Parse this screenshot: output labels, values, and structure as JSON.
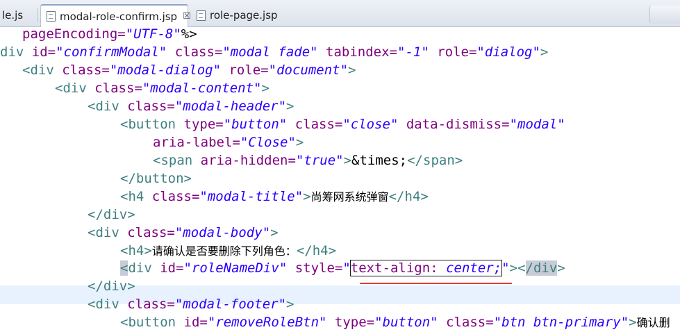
{
  "tabs": [
    {
      "label": "le.js",
      "active": false
    },
    {
      "label": "modal-role-confirm.jsp",
      "active": true,
      "close": "☒"
    },
    {
      "label": "role-page.jsp",
      "active": false
    }
  ],
  "code": {
    "l1": {
      "a": "pageEncoding=",
      "b": "\"UTF-8\"",
      "c": "%>"
    },
    "l2": {
      "t": "div",
      "a1": " id=",
      "v1": "\"confirmModal\"",
      "a2": " class=",
      "v2": "\"modal fade\"",
      "a3": " tabindex=",
      "v3": "\"-1\"",
      "a4": " role=",
      "v4": "\"dialog\"",
      "e": ">"
    },
    "l3": {
      "o": "<",
      "t": "div",
      "a1": " class=",
      "v1": "\"modal-dialog\"",
      "a2": " role=",
      "v2": "\"document\"",
      "e": ">"
    },
    "l4": {
      "o": "<",
      "t": "div",
      "a1": " class=",
      "v1": "\"modal-content\"",
      "e": ">"
    },
    "l5": {
      "o": "<",
      "t": "div",
      "a1": " class=",
      "v1": "\"modal-header\"",
      "e": ">"
    },
    "l6": {
      "o": "<",
      "t": "button",
      "a1": " type=",
      "v1": "\"button\"",
      "a2": " class=",
      "v2": "\"close\"",
      "a3": " data-dismiss=",
      "v3": "\"modal\""
    },
    "l7": {
      "a1": "aria-label=",
      "v1": "\"Close\"",
      "e": ">"
    },
    "l8": {
      "o": "<",
      "t": "span",
      "a1": " aria-hidden=",
      "v1": "\"true\"",
      "m": ">",
      "ent": "&times;",
      "c": "</",
      "t2": "span",
      "e": ">"
    },
    "l9": {
      "o": "</",
      "t": "button",
      "e": ">"
    },
    "l10": {
      "o": "<",
      "t": "h4",
      "a1": " class=",
      "v1": "\"modal-title\"",
      "m": ">",
      "text": "尚筹网系统弹窗",
      "c": "</",
      "t2": "h4",
      "e": ">"
    },
    "l11": {
      "o": "</",
      "t": "div",
      "e": ">"
    },
    "l12": {
      "o": "<",
      "t": "div",
      "a1": " class=",
      "v1": "\"modal-body\"",
      "e": ">"
    },
    "l13": {
      "o": "<",
      "t": "h4",
      "m": ">",
      "text": "请确认是否要删除下列角色：",
      "c": "</",
      "t2": "h4",
      "e": ">"
    },
    "l14": {
      "o": "<",
      "t": "div",
      "a1": " id=",
      "v1": "\"roleNameDiv\"",
      "a2": " style=",
      "q": "\"",
      "sv1": "text-align: ",
      "sv2": "center;",
      "q2": "\"",
      "m": ">",
      "c": "<",
      "c2": "/",
      "t2": "div",
      "e": ">"
    },
    "l15": {
      "o": "</",
      "t": "div",
      "e": ">"
    },
    "l16": {
      "o": "<",
      "t": "div",
      "a1": " class=",
      "v1": "\"modal-footer\"",
      "e": ">"
    },
    "l17": {
      "o": "<",
      "t": "button",
      "a1": " id=",
      "v1": "\"removeRoleBtn\"",
      "a2": " type=",
      "v2": "\"button\"",
      "a3": " class=",
      "v3": "\"btn btn-primary\"",
      "m": ">",
      "text": "确认删"
    }
  },
  "colors": {
    "tag": "#3f7f7f",
    "attribute": "#7f007f",
    "value": "#2a00ff",
    "highlight_row": "#e8f2fe",
    "underline": "#e53935"
  }
}
